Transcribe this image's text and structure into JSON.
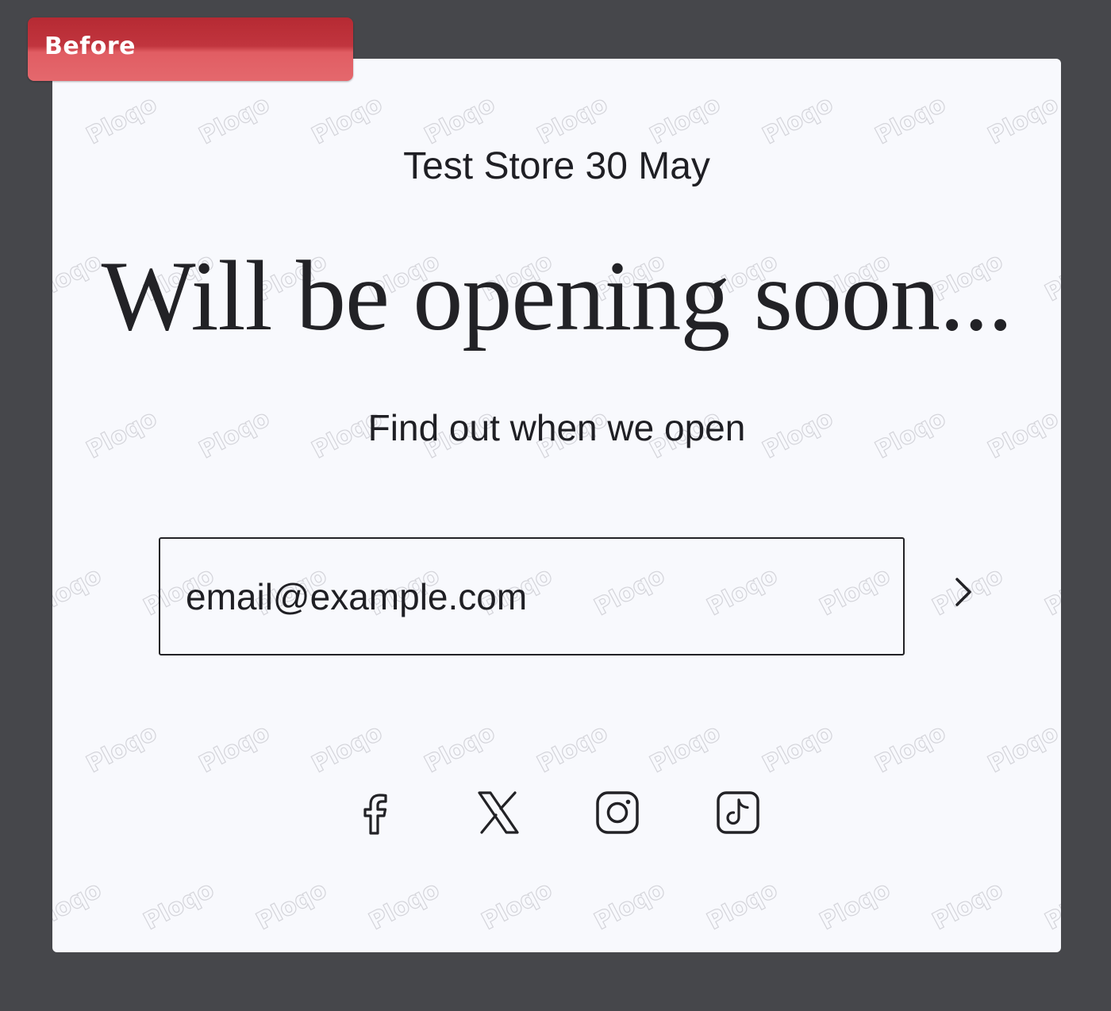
{
  "badge": {
    "label": "Before",
    "color": "#c1353e"
  },
  "store": {
    "name": "Test Store 30 May"
  },
  "main": {
    "headline": "Will be opening soon...",
    "subline": "Find out when we open"
  },
  "signup": {
    "email_placeholder": "email@example.com",
    "submit_icon": "chevron-right-icon"
  },
  "social": {
    "icons": [
      "facebook-icon",
      "x-icon",
      "instagram-icon",
      "tiktok-icon"
    ]
  },
  "watermark": {
    "text": "Ploqo"
  }
}
